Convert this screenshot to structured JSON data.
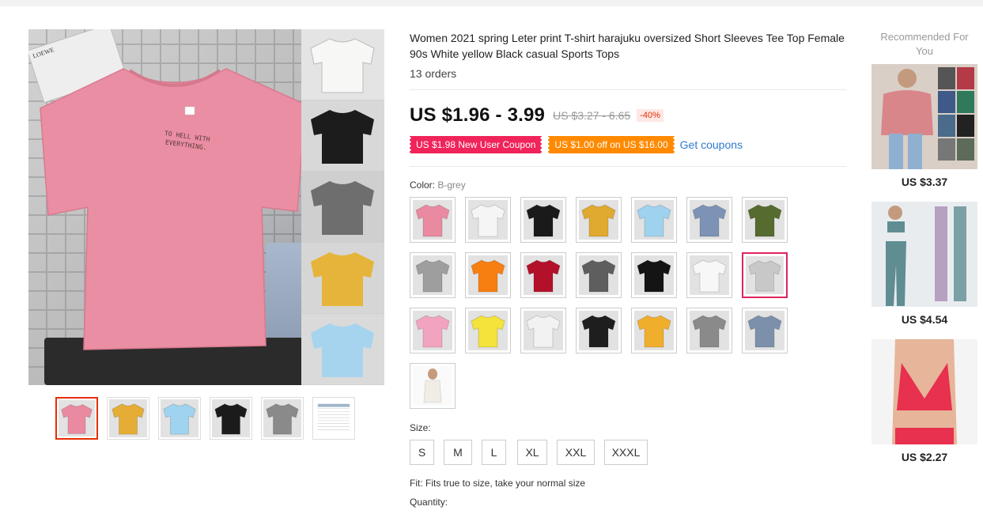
{
  "product": {
    "title": "Women 2021 spring Leter print T-shirt harajuku oversized Short Sleeves Tee Top Female 90s White yellow Black casual Sports Tops",
    "orders": "13 orders",
    "price": "US $1.96 - 3.99",
    "original_price": "US $3.27 - 6.65",
    "discount": "-40%"
  },
  "main_image": {
    "print_text": "TO HELL WITH EVERYTHING.",
    "card_text": "LOEWE",
    "strip_colors": [
      "#f7f7f5",
      "#1c1c1c",
      "#6e6e6e",
      "#e6b43a",
      "#a6d4ee"
    ]
  },
  "thumbnails": [
    {
      "color": "#e98aa0",
      "active": true
    },
    {
      "color": "#e5ad35",
      "active": false
    },
    {
      "color": "#9fd3ef",
      "active": false
    },
    {
      "color": "#1b1b1b",
      "active": false
    },
    {
      "color": "#8a8a8a",
      "active": false
    },
    {
      "color": "#f3f3f3",
      "active": false
    }
  ],
  "coupons": {
    "new_user": "US $1.98 New User Coupon",
    "store": "US $1.00 off on US $16.00",
    "get_label": "Get coupons"
  },
  "color": {
    "label": "Color:",
    "value": "B-grey",
    "swatches": [
      {
        "color": "#e98aa0",
        "selected": false
      },
      {
        "color": "#f5f5f5",
        "selected": false
      },
      {
        "color": "#1a1a1a",
        "selected": false
      },
      {
        "color": "#e0a92f",
        "selected": false
      },
      {
        "color": "#9fd2ee",
        "selected": false
      },
      {
        "color": "#7d93b5",
        "selected": false
      },
      {
        "color": "#556b2f",
        "selected": false
      },
      {
        "color": "#9e9e9e",
        "selected": false
      },
      {
        "color": "#f77f11",
        "selected": false
      },
      {
        "color": "#b3102a",
        "selected": false
      },
      {
        "color": "#5e5e5e",
        "selected": false
      },
      {
        "color": "#141414",
        "selected": false
      },
      {
        "color": "#f7f7f7",
        "selected": false
      },
      {
        "color": "#c8c8c8",
        "selected": true
      },
      {
        "color": "#f2a3bf",
        "selected": false
      },
      {
        "color": "#f3e33a",
        "selected": false
      },
      {
        "color": "#f2f2f2",
        "selected": false
      },
      {
        "color": "#1e1e1e",
        "selected": false
      },
      {
        "color": "#efae2b",
        "selected": false
      },
      {
        "color": "#8a8a8a",
        "selected": false
      },
      {
        "color": "#7c90ab",
        "selected": false
      },
      {
        "color": "#f1ece6",
        "selected": false
      }
    ]
  },
  "size": {
    "label": "Size:",
    "options": [
      "S",
      "M",
      "L",
      "XL",
      "XXL",
      "XXXL"
    ]
  },
  "fit": "Fit: Fits true to size, take your normal size",
  "quantity_label": "Quantity:",
  "recommended": {
    "title": "Recommended For You",
    "items": [
      {
        "price": "US $3.37",
        "color": "#d9868a"
      },
      {
        "price": "US $4.54",
        "color": "#5f8d92"
      },
      {
        "price": "US $2.27",
        "color": "#e8304f"
      }
    ]
  }
}
